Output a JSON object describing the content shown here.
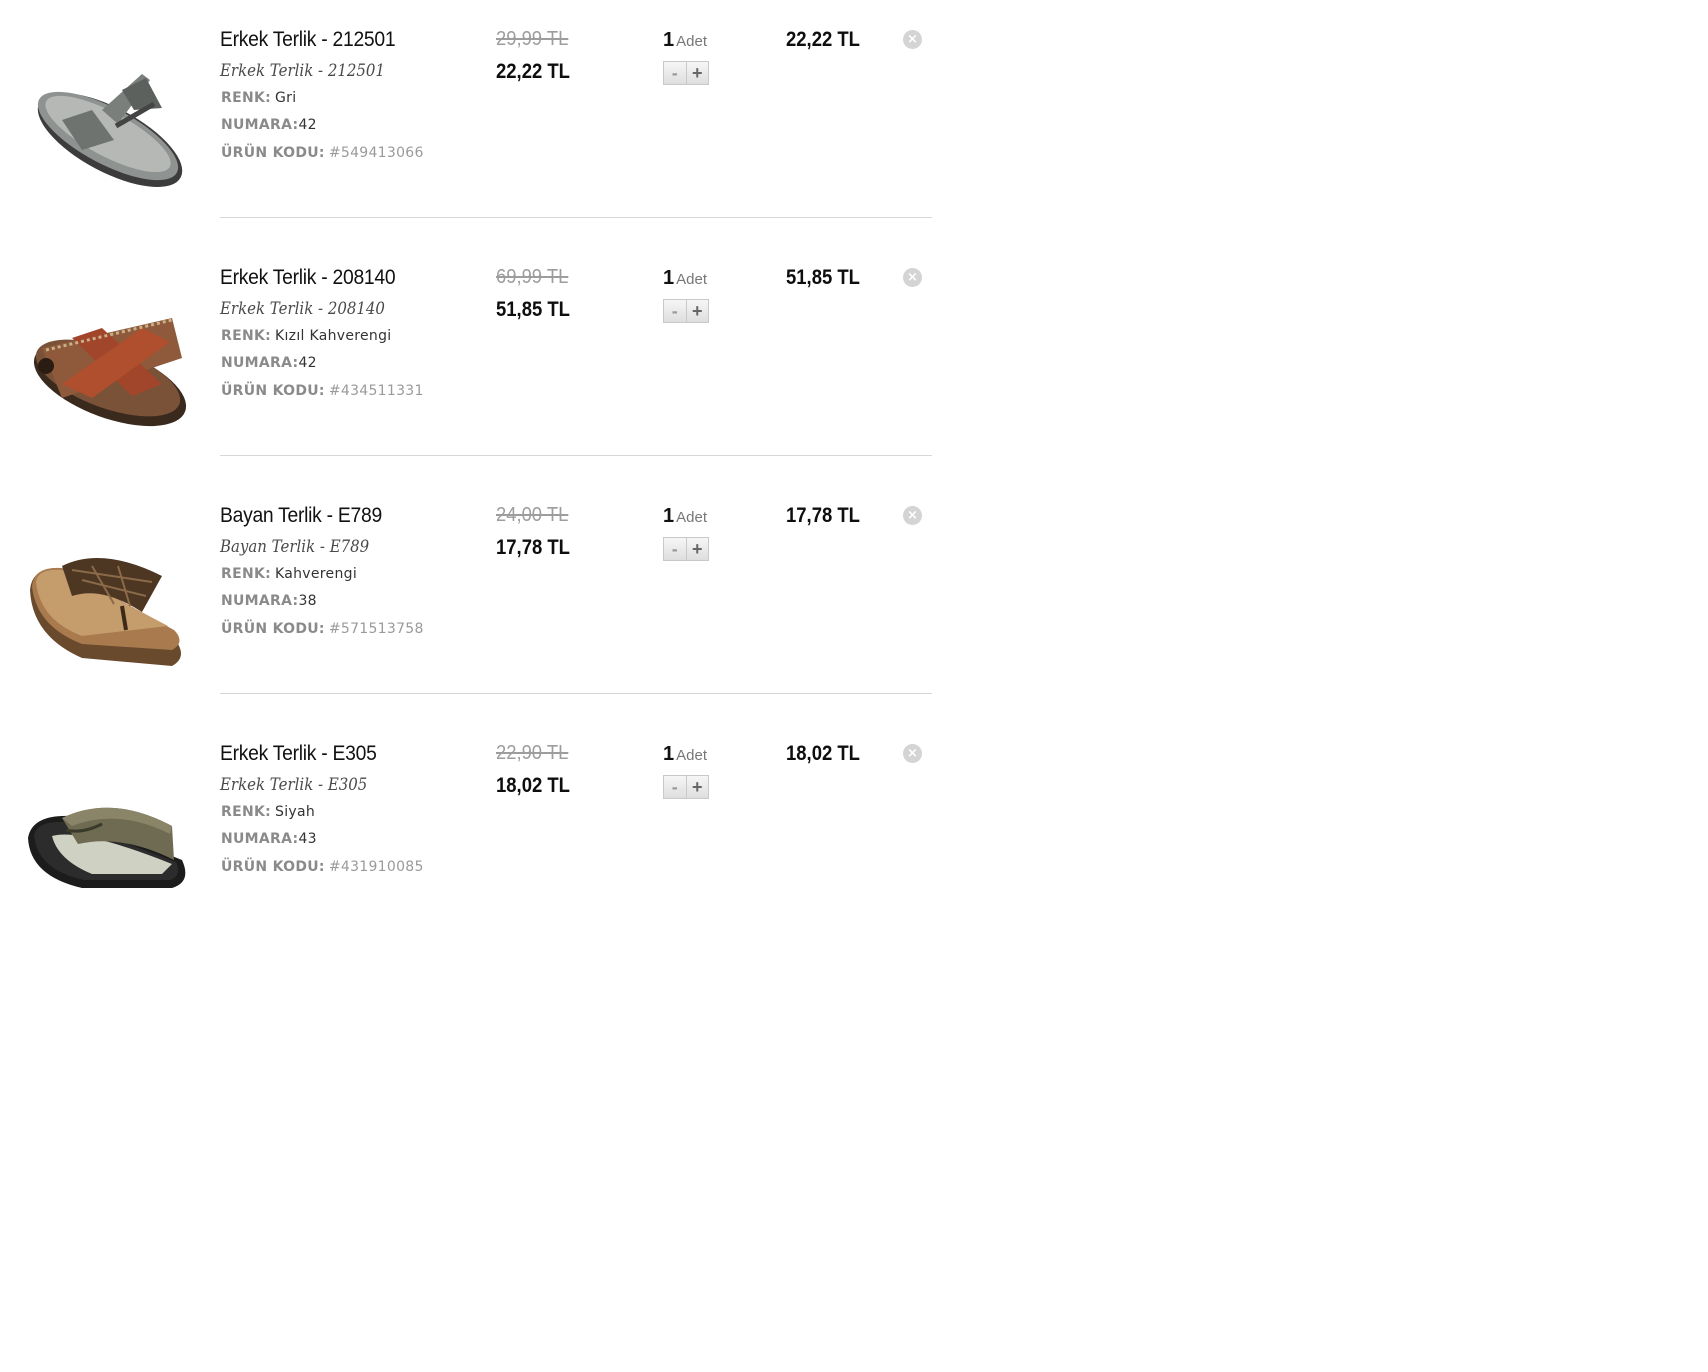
{
  "cart": {
    "items": [
      {
        "title": "Erkek Terlik - 212501",
        "subtitle": "Erkek Terlik - 212501",
        "color_label": "RENK:",
        "color_value": "Gri",
        "size_label": "NUMARA:",
        "size_value": "42",
        "code_label": "ÜRÜN KODU:",
        "code_value": "#549413066",
        "old_price": "29,99 TL",
        "new_price": "22,22 TL",
        "quantity": "1",
        "quantity_unit": "Adet",
        "minus": "-",
        "plus": "+",
        "total": "22,22 TL",
        "remove": "×",
        "image_icon": "gray-flip-flop"
      },
      {
        "title": "Erkek Terlik - 208140",
        "subtitle": "Erkek Terlik - 208140",
        "color_label": "RENK:",
        "color_value": "Kızıl Kahverengi",
        "size_label": "NUMARA:",
        "size_value": "42",
        "code_label": "ÜRÜN KODU:",
        "code_value": "#434511331",
        "old_price": "69,99 TL",
        "new_price": "51,85 TL",
        "quantity": "1",
        "quantity_unit": "Adet",
        "minus": "-",
        "plus": "+",
        "total": "51,85 TL",
        "remove": "×",
        "image_icon": "brown-cross-strap-sandal"
      },
      {
        "title": "Bayan Terlik - E789",
        "subtitle": "Bayan Terlik - E789",
        "color_label": "RENK:",
        "color_value": "Kahverengi",
        "size_label": "NUMARA:",
        "size_value": "38",
        "code_label": "ÜRÜN KODU:",
        "code_value": "#571513758",
        "old_price": "24,00 TL",
        "new_price": "17,78 TL",
        "quantity": "1",
        "quantity_unit": "Adet",
        "minus": "-",
        "plus": "+",
        "total": "17,78 TL",
        "remove": "×",
        "image_icon": "brown-wedge-flip-flop"
      },
      {
        "title": "Erkek Terlik - E305",
        "subtitle": "Erkek Terlik - E305",
        "color_label": "RENK:",
        "color_value": "Siyah",
        "size_label": "NUMARA:",
        "size_value": "43",
        "code_label": "ÜRÜN KODU:",
        "code_value": "#431910085",
        "old_price": "22,90 TL",
        "new_price": "18,02 TL",
        "quantity": "1",
        "quantity_unit": "Adet",
        "minus": "-",
        "plus": "+",
        "total": "18,02 TL",
        "remove": "×",
        "image_icon": "black-slide-sandal"
      }
    ]
  },
  "colors": {
    "old_price": "#9d9d9d",
    "divider": "#d8d8d8",
    "remove_icon": "#d4d4d4"
  }
}
